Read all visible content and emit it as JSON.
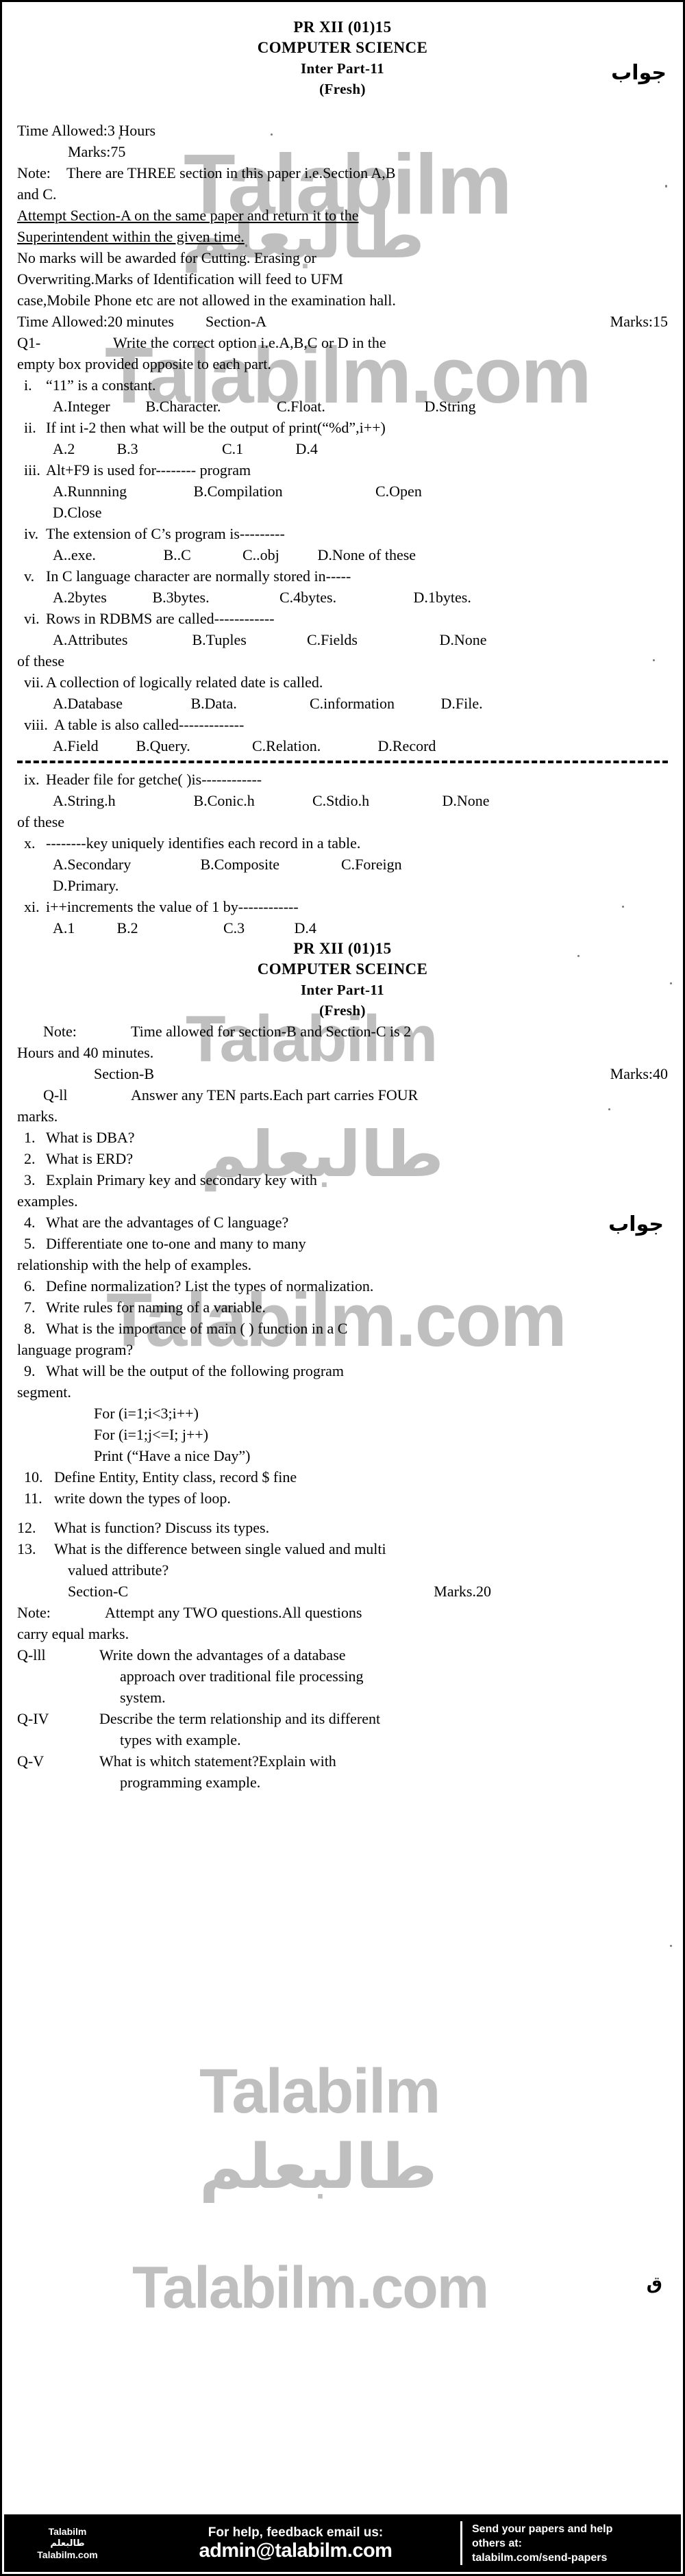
{
  "paper": {
    "code": "PR XII (01)15",
    "subject": "COMPUTER SCIENCE",
    "subject_alt": "COMPUTER SCEINCE",
    "part": "Inter Part-11",
    "session": "(Fresh)",
    "time_allowed": "Time Allowed:3 Hours",
    "marks": "Marks:75"
  },
  "notes": {
    "note_label": "Note:",
    "note_line1": "There are THREE section in this paper i.e.Section A,B",
    "note_line2": "and C.",
    "underline_line1": "Attempt Section-A on the same paper and return it to the",
    "underline_line2": "Superintendent within the given time.",
    "plain_line1": "No marks will be awarded for Cutting. Erasing or",
    "plain_line2": "Overwriting.Marks of Identification will feed to UFM",
    "plain_line3": "case,Mobile Phone etc are not allowed in the examination hall."
  },
  "section_a": {
    "time": "Time Allowed:20 minutes",
    "name": "Section-A",
    "marks": "Marks:15",
    "q_tag": "Q1-",
    "q_text_line1": "Write the correct option i.e.A,B,C or D in the",
    "q_text_line2": "empty box provided opposite to  each part.",
    "items": [
      {
        "num": "i.",
        "text": "“11” is a constant.",
        "options": [
          "A.Integer",
          "B.Character.",
          "C.Float.",
          "D.String"
        ],
        "options_extra": []
      },
      {
        "num": "ii.",
        "text": "If int i-2 then what will be the output of print(“%d”,i++)",
        "options": [
          "A.2",
          "B.3",
          "C.1",
          "D.4"
        ],
        "options_extra": []
      },
      {
        "num": "iii.",
        "text": "Alt+F9 is used for-------- program",
        "options": [
          "A.Runnning",
          "B.Compilation",
          "C.Open"
        ],
        "options_extra": [
          "D.Close"
        ]
      },
      {
        "num": "iv.",
        "text": "The extension of C’s program is---------",
        "options": [
          "A..exe.",
          "B..C",
          "C..obj",
          "D.None of these"
        ],
        "options_extra": []
      },
      {
        "num": "v.",
        "text": "In C language character are normally stored in-----",
        "options": [
          "A.2bytes",
          "B.3bytes.",
          "C.4bytes.",
          "D.1bytes."
        ],
        "options_extra": []
      },
      {
        "num": "vi.",
        "text": "Rows in RDBMS are called------------",
        "options": [
          "A.Attributes",
          "B.Tuples",
          "C.Fields",
          "D.None"
        ],
        "options_extra": [
          "of these"
        ]
      },
      {
        "num": "vii.",
        "text": "A collection of logically related date is called.",
        "options": [
          "A.Database",
          "B.Data.",
          "C.information",
          "D.File."
        ],
        "options_extra": []
      },
      {
        "num": "viii.",
        "text": "A table is also called-------------",
        "options": [
          "A.Field",
          "B.Query.",
          "C.Relation.",
          "D.Record"
        ],
        "options_extra": []
      },
      {
        "num": "ix.",
        "text": "Header file for getche( )is------------",
        "options": [
          "A.String.h",
          "B.Conic.h",
          "C.Stdio.h",
          "D.None"
        ],
        "options_extra": [
          "of these"
        ]
      },
      {
        "num": "x.",
        "text": "--------key uniquely identifies each record in a table.",
        "options": [
          "A.Secondary",
          "B.Composite",
          "C.Foreign"
        ],
        "options_extra": [
          "D.Primary."
        ]
      },
      {
        "num": "xi.",
        "text": "i++increments the value of 1 by------------",
        "options": [
          "A.1",
          "B.2",
          "C.3",
          "D.4"
        ],
        "options_extra": []
      }
    ]
  },
  "section_b": {
    "note_label": "Note:",
    "note_line1": "Time allowed for section-B and Section-C is 2",
    "note_line2": "Hours and 40 minutes.",
    "name": "Section-B",
    "marks": "Marks:40",
    "q_tag": "Q-ll",
    "q_text_line1": "Answer any TEN parts.Each part carries FOUR",
    "q_text_line2": "marks.",
    "items": [
      {
        "num": "1.",
        "lines": [
          "What is DBA?"
        ]
      },
      {
        "num": "2.",
        "lines": [
          "What is ERD?"
        ]
      },
      {
        "num": "3.",
        "lines": [
          "Explain Primary key and secondary key with",
          "examples."
        ]
      },
      {
        "num": "4.",
        "lines": [
          "What are the advantages of C language?"
        ]
      },
      {
        "num": "5.",
        "lines": [
          "Differentiate one to-one and many to many",
          "relationship with the help of examples."
        ]
      },
      {
        "num": "6.",
        "lines": [
          "Define normalization? List the types of normalization."
        ]
      },
      {
        "num": "7.",
        "lines": [
          "Write rules for naming of a variable."
        ]
      },
      {
        "num": "8.",
        "lines": [
          "What is the importance of main ( ) function in a C",
          "language program?"
        ]
      },
      {
        "num": "9.",
        "lines": [
          "What will be the output of the following program",
          "segment."
        ]
      }
    ],
    "code_lines": [
      "For (i=1;i<3;i++)",
      "For (i=1;j<=I; j++)",
      "Print (“Have a nice Day”)"
    ],
    "items_tail": [
      {
        "num": "10.",
        "lines": [
          "Define Entity, Entity class, record $ fine"
        ]
      },
      {
        "num": "11.",
        "lines": [
          "write down the types of loop."
        ]
      },
      {
        "num": "12.",
        "lines": [
          "What is function? Discuss its types."
        ]
      },
      {
        "num": "13.",
        "lines": [
          "What is the difference between single valued and multi",
          "valued attribute?"
        ]
      }
    ]
  },
  "section_c": {
    "name": "Section-C",
    "marks": "Marks.20",
    "note_label": "Note:",
    "note_line1": "Attempt any TWO questions.All questions",
    "note_line2": "carry equal marks.",
    "questions": [
      {
        "tag": "Q-lll",
        "lines": [
          "Write down the advantages of a database",
          "approach over traditional file processing",
          "system."
        ]
      },
      {
        "tag": "Q-IV",
        "lines": [
          "Describe the term relationship and its different",
          "types with example."
        ]
      },
      {
        "tag": "Q-V",
        "lines": [
          "What is whitch statement?Explain with",
          "programming example."
        ]
      }
    ]
  },
  "urdu_marks": {
    "top_right": "جواب",
    "mid_right": "جواب",
    "bottom_right": "ق"
  },
  "watermarks": {
    "latin": "Talabilm",
    "latin_dotcom": "Talabilm.com",
    "arabic": "طالبعلم"
  },
  "footer": {
    "brand_line1": "Talabilm",
    "brand_line2": "طالبعلم",
    "brand_line3": "Talabilm.com",
    "help_text": "For help, feedback email us:",
    "email": "admin@talabilm.com",
    "send_text_line1": "Send your papers and help",
    "send_text_line2": "others at:",
    "send_url": "talabilm.com/send-papers"
  }
}
